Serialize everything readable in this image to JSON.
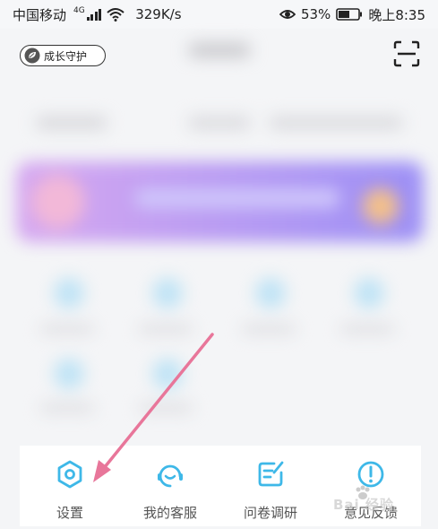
{
  "status_bar": {
    "carrier": "中国移动",
    "network": "4G",
    "speed": "329K/s",
    "battery": "53%",
    "time": "晚上8:35"
  },
  "header": {
    "badge_label": "成长守护",
    "badge_icon": "leaf-icon",
    "scan_icon": "scan-icon"
  },
  "tabbar": {
    "items": [
      {
        "label": "设置",
        "icon": "hexagon-settings-icon"
      },
      {
        "label": "我的客服",
        "icon": "headset-smile-icon"
      },
      {
        "label": "问卷调研",
        "icon": "survey-edit-icon"
      },
      {
        "label": "意见反馈",
        "icon": "exclamation-circle-icon"
      }
    ]
  },
  "colors": {
    "accent": "#3eb8e8",
    "arrow": "#e8769a",
    "banner_start": "#d6a8f0",
    "banner_end": "#9c8ff5"
  },
  "watermark": {
    "text": "Bai 经验"
  }
}
